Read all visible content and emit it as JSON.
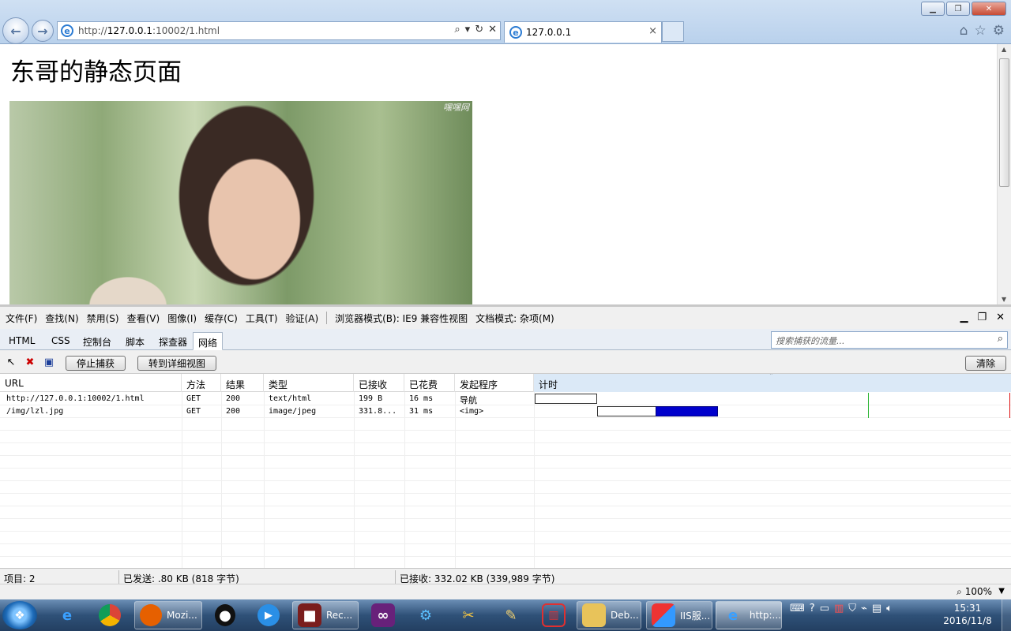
{
  "browser": {
    "address": "http://127.0.0.1:10002/1.html",
    "address_host": "127.0.0.1",
    "address_prefix": "http://",
    "address_suffix": ":10002/1.html",
    "tab_title": "127.0.0.1"
  },
  "page": {
    "title": "东哥的静态页面",
    "watermark": "嘿嘿网"
  },
  "devtools": {
    "menu": [
      "文件(F)",
      "查找(N)",
      "禁用(S)",
      "查看(V)",
      "图像(I)",
      "缓存(C)",
      "工具(T)",
      "验证(A)"
    ],
    "browser_mode": "浏览器模式(B): IE9 兼容性视图",
    "doc_mode": "文档模式: 杂项(M)",
    "tabs": [
      "HTML",
      "CSS",
      "控制台",
      "脚本",
      "探查器",
      "网络"
    ],
    "active_tab": "网络",
    "search_placeholder": "搜索捕获的流量...",
    "stop_capture": "停止捕获",
    "detail_view": "转到详细视图",
    "clear": "清除",
    "columns": [
      "URL",
      "方法",
      "结果",
      "类型",
      "已接收",
      "已花费",
      "发起程序",
      "计时"
    ],
    "rows": [
      {
        "url": "http://127.0.0.1:10002/1.html",
        "method": "GET",
        "result": "200",
        "type": "text/html",
        "received": "199 B",
        "taken": "16 ms",
        "initiator": "导航"
      },
      {
        "url": "/img/lzl.jpg",
        "method": "GET",
        "result": "200",
        "type": "image/jpeg",
        "received": "331.8...",
        "taken": "31 ms",
        "initiator": "<img>"
      }
    ],
    "status": {
      "items": "项目: 2",
      "sent": "已发送: .80 KB (818 字节)",
      "received": "已接收: 332.02 KB (339,989 字节)"
    },
    "zoom": "100%"
  },
  "taskbar": {
    "items": [
      {
        "label": "Mozi...",
        "icon": "firefox-icon"
      },
      {
        "label": "Rec...",
        "icon": "recorder-icon"
      },
      {
        "label": "Deb...",
        "icon": "folder-icon"
      },
      {
        "label": "IIS服...",
        "icon": "iis-icon"
      },
      {
        "label": "http:...",
        "icon": "ie-icon"
      }
    ],
    "time": "15:31",
    "date": "2016/11/8"
  }
}
